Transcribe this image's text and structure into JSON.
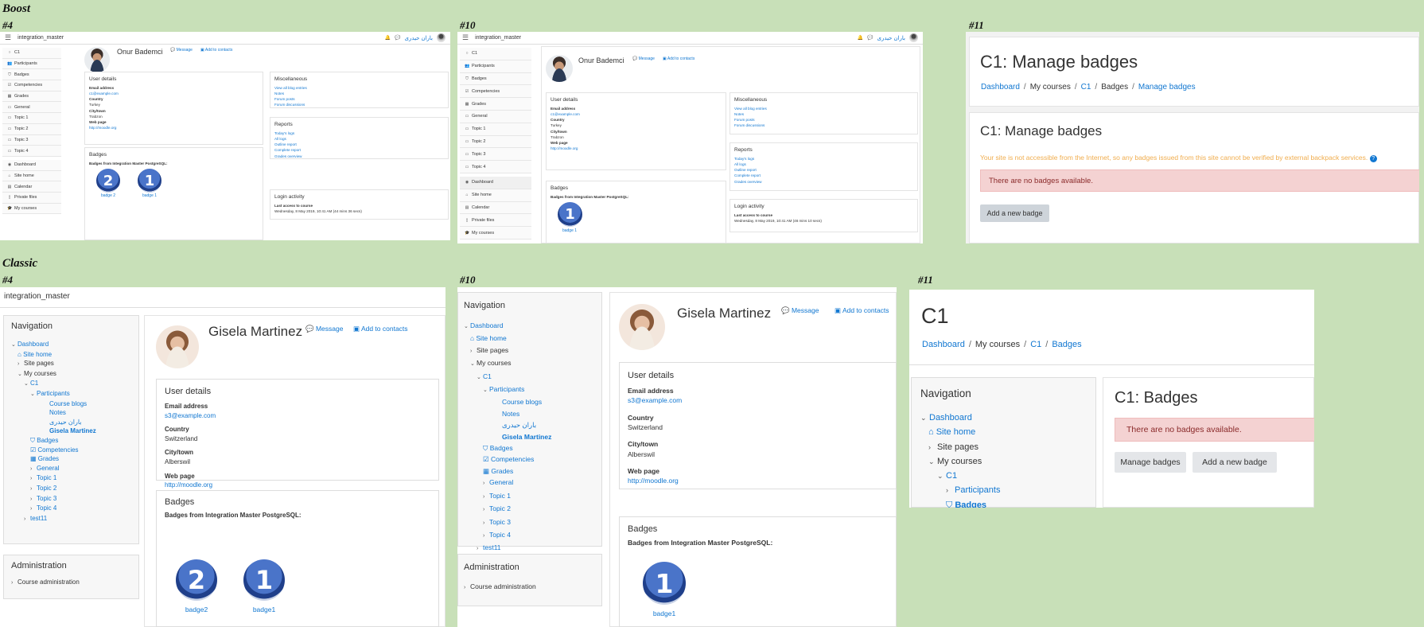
{
  "sections": {
    "boost": "Boost",
    "classic": "Classic"
  },
  "panel_tags": {
    "p4": "#4",
    "p10": "#10",
    "p11": "#11"
  },
  "colors": {
    "link": "#1177d1",
    "background": "#c8e0b8",
    "alert_bg": "#f4d2d2",
    "warning_text": "#f0ad4e"
  },
  "boost": {
    "site_name": "integration_master",
    "user_menu_name": "باران حیدری",
    "nav_items": [
      {
        "icon": "circle-icon",
        "label": "C1"
      },
      {
        "icon": "users-icon",
        "label": "Participants"
      },
      {
        "icon": "shield-icon",
        "label": "Badges"
      },
      {
        "icon": "check-square-icon",
        "label": "Competencies"
      },
      {
        "icon": "table-icon",
        "label": "Grades"
      },
      {
        "icon": "folder-icon",
        "label": "General"
      },
      {
        "icon": "folder-icon",
        "label": "Topic 1"
      },
      {
        "icon": "folder-icon",
        "label": "Topic 2"
      },
      {
        "icon": "folder-icon",
        "label": "Topic 3"
      },
      {
        "icon": "folder-icon",
        "label": "Topic 4"
      }
    ],
    "nav_items_b": [
      {
        "icon": "dashboard-icon",
        "label": "Dashboard"
      },
      {
        "icon": "home-icon",
        "label": "Site home"
      },
      {
        "icon": "calendar-icon",
        "label": "Calendar"
      },
      {
        "icon": "file-icon",
        "label": "Private files"
      },
      {
        "icon": "graduation-cap-icon",
        "label": "My courses"
      }
    ],
    "profile": {
      "name": "Onur Bademci",
      "message": "Message",
      "add_contacts": "Add to contacts",
      "user_details": "User details",
      "email_label": "Email address",
      "email": "c1@example.com",
      "country_label": "Country",
      "country": "Turkey",
      "city_label": "City/town",
      "city": "Trabzon",
      "web_label": "Web page",
      "web": "http://moodle.org",
      "badges_title": "Badges",
      "badges_from": "Badges from Integration Master PostgreSQL:",
      "badge2_label": "badge 2",
      "badge1_label": "badge 1",
      "misc_title": "Miscellaneous",
      "misc_links": [
        "View all blog entries",
        "Notes",
        "Forum posts",
        "Forum discussions"
      ],
      "reports_title": "Reports",
      "reports_links": [
        "Today's logs",
        "All logs",
        "Outline report",
        "Complete report",
        "Grades overview"
      ],
      "login_title": "Login activity",
      "last_access_label": "Last access to course",
      "last_access_4": "Wednesday, 8 May 2019, 10:41 AM  (44 mins 36 secs)",
      "last_access_10": "Wednesday, 8 May 2019, 10:41 AM  (46 mins 10 secs)"
    },
    "manage": {
      "title": "C1: Manage badges",
      "breadcrumb": [
        "Dashboard",
        "My courses",
        "C1",
        "Badges",
        "Manage badges"
      ],
      "heading": "C1: Manage badges",
      "warning": "Your site is not accessible from the Internet, so any badges issued from this site cannot be verified by external backpack services.",
      "help_icon": "question-circle-icon",
      "no_badges": "There are no badges available.",
      "add_button": "Add a new badge"
    }
  },
  "classic": {
    "site_name": "integration_master",
    "nav_title": "Navigation",
    "nav": {
      "dashboard": "Dashboard",
      "site_home": "Site home",
      "site_pages": "Site pages",
      "my_courses": "My courses",
      "c1": "C1",
      "participants": "Participants",
      "course_blogs": "Course blogs",
      "notes": "Notes",
      "rtl_user": "باران حیدری",
      "current_user": "Gisela Martinez",
      "badges": "Badges",
      "competencies": "Competencies",
      "grades": "Grades",
      "general": "General",
      "topic1": "Topic 1",
      "topic2": "Topic 2",
      "topic3": "Topic 3",
      "topic4": "Topic 4",
      "test11": "test11"
    },
    "admin_title": "Administration",
    "course_admin": "Course administration",
    "profile": {
      "name": "Gisela Martinez",
      "message": "Message",
      "add_contacts": "Add to contacts",
      "user_details": "User details",
      "email_label": "Email address",
      "email": "s3@example.com",
      "country_label": "Country",
      "country": "Switzerland",
      "city_label": "City/town",
      "city": "Alberswil",
      "web_label": "Web page",
      "web": "http://moodle.org",
      "badges_title": "Badges",
      "badges_from": "Badges from Integration Master PostgreSQL:",
      "badge2_label": "badge2",
      "badge1_label": "badge1"
    },
    "badges_page": {
      "title": "C1",
      "breadcrumb": [
        "Dashboard",
        "My courses",
        "C1",
        "Badges"
      ],
      "heading": "C1: Badges",
      "no_badges": "There are no badges available.",
      "manage_button": "Manage badges",
      "add_button": "Add a new badge"
    }
  }
}
